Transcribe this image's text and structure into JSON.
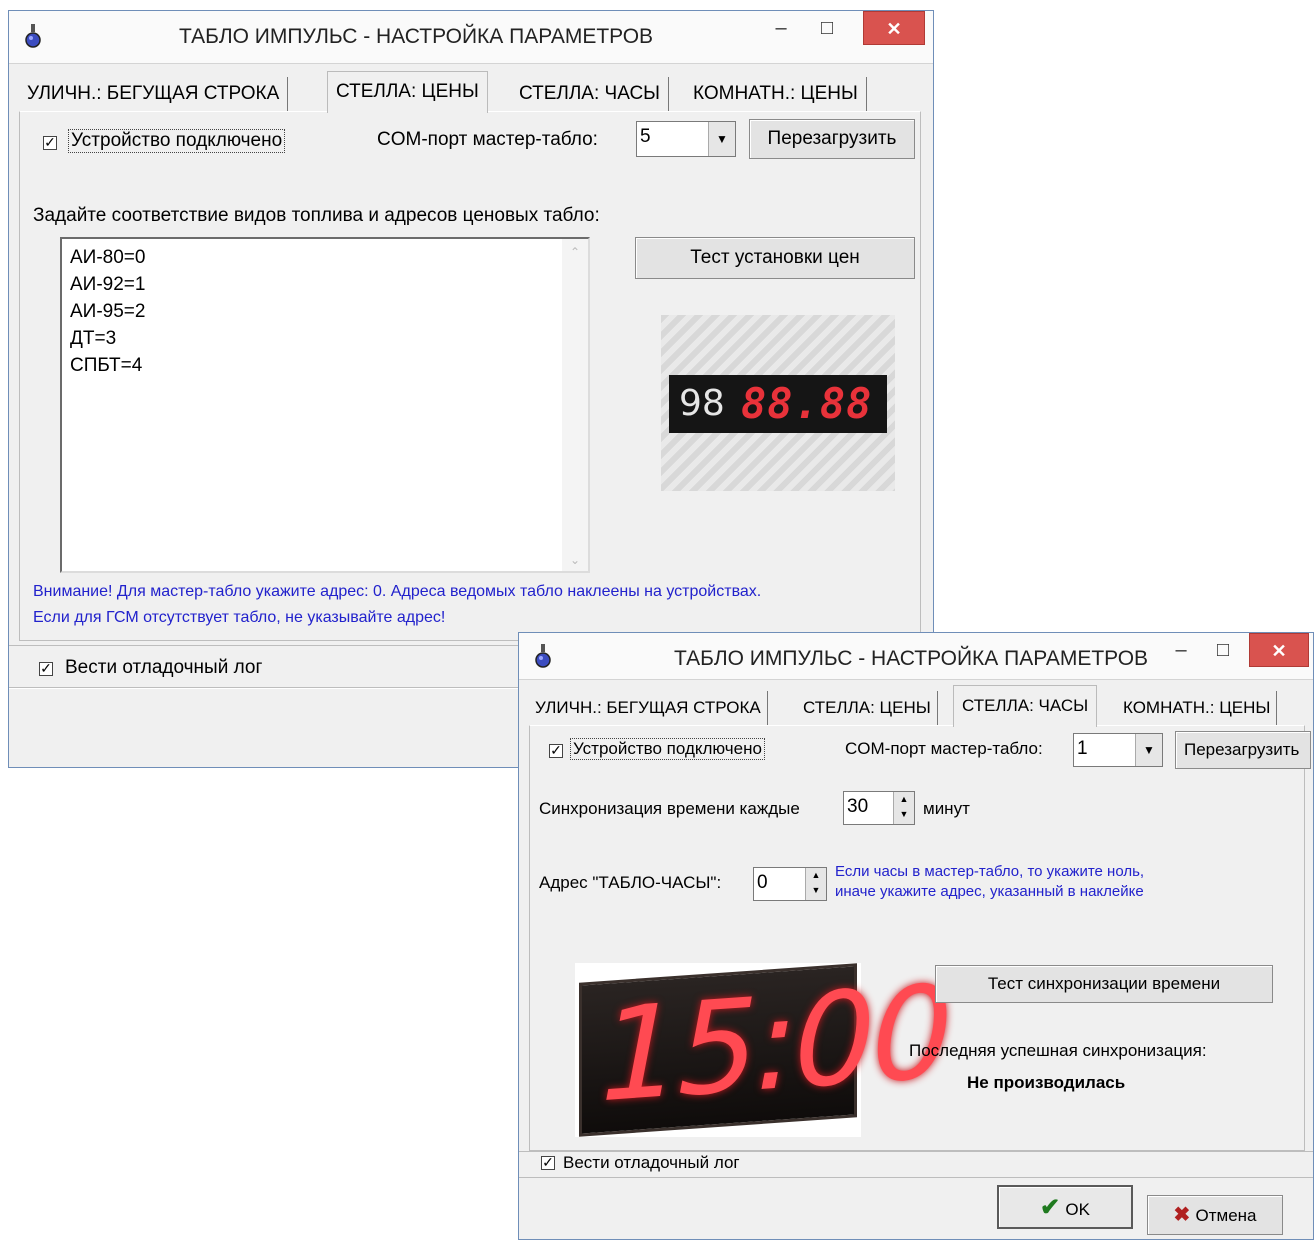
{
  "window1": {
    "title": "ТАБЛО ИМПУЛЬС - НАСТРОЙКА ПАРАМЕТРОВ",
    "tabs": [
      "УЛИЧН.: БЕГУЩАЯ СТРОКА",
      "СТЕЛЛА: ЦЕНЫ",
      "СТЕЛЛА: ЧАСЫ",
      "КОМНАТН.: ЦЕНЫ"
    ],
    "active_tab": "СТЕЛЛА: ЦЕНЫ",
    "device_connected_label": "Устройство подключено",
    "com_port_label": "COM-порт мастер-табло:",
    "com_port_value": "5",
    "reload_button": "Перезагрузить",
    "mapping_label": "Задайте соответствие видов топлива и адресов ценовых табло:",
    "fuel_map": [
      "АИ-80=0",
      "АИ-92=1",
      "АИ-95=2",
      "ДТ=3",
      "СПБТ=4"
    ],
    "test_prices_button": "Тест установки цен",
    "price_display": {
      "label": "98",
      "digits": "88.88"
    },
    "note_line1": "Внимание! Для мастер-табло укажите адрес: 0. Адреса ведомых табло наклеены на устройствах.",
    "note_line2": "Если для ГСМ отсутствует табло, не указывайте адрес!",
    "debug_log_label": "Вести отладочный лог"
  },
  "window2": {
    "title": "ТАБЛО ИМПУЛЬС - НАСТРОЙКА ПАРАМЕТРОВ",
    "tabs": [
      "УЛИЧН.: БЕГУЩАЯ СТРОКА",
      "СТЕЛЛА: ЦЕНЫ",
      "СТЕЛЛА: ЧАСЫ",
      "КОМНАТН.: ЦЕНЫ"
    ],
    "active_tab": "СТЕЛЛА: ЧАСЫ",
    "device_connected_label": "Устройство подключено",
    "com_port_label": "COM-порт мастер-табло:",
    "com_port_value": "1",
    "reload_button": "Перезагрузить",
    "sync_label": "Синхронизация времени каждые",
    "sync_value": "30",
    "sync_unit": "минут",
    "address_label": "Адрес \"ТАБЛО-ЧАСЫ\":",
    "address_value": "0",
    "address_note1": "Если часы в мастер-табло, то укажите ноль,",
    "address_note2": "иначе укажите адрес, указанный в наклейке",
    "clock_display": "15:00",
    "test_sync_button": "Тест синхронизации времени",
    "last_sync_label": "Последняя успешная синхронизация:",
    "last_sync_value": "Не производилась",
    "debug_log_label": "Вести отладочный лог",
    "ok_button": "OK",
    "cancel_button": "Отмена"
  },
  "colors": {
    "note_blue": "#2222cc",
    "close_red": "#d9534f",
    "led_red": "#e8323a"
  }
}
